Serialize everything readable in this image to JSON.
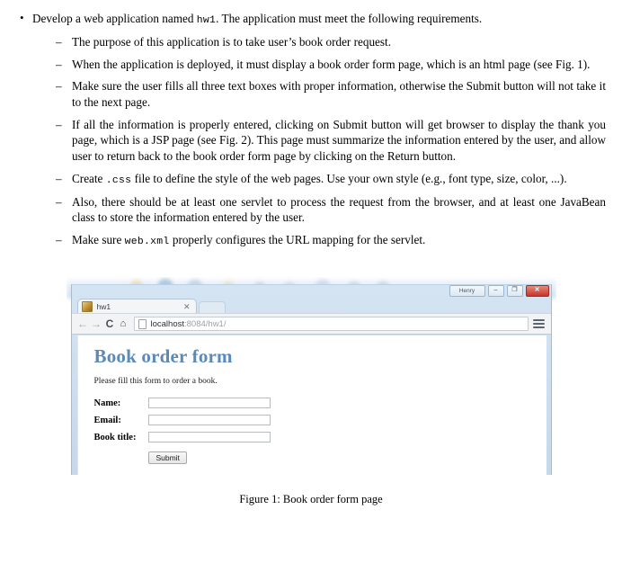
{
  "document": {
    "bullet_glyph": "•",
    "dash_glyph": "–",
    "top_item": {
      "pre": "Develop a web application named ",
      "code": "hw1",
      "post": ". The application must meet the following requirements."
    },
    "requirements": [
      {
        "id": "purpose",
        "text": "The purpose of this application is to take user’s book order request."
      },
      {
        "id": "deploy",
        "text": "When the application is deployed, it must display a book order form page, which is an html page (see Fig. 1)."
      },
      {
        "id": "validation",
        "text": "Make sure the user fills all three text boxes with proper information, otherwise the Submit button will not take it to the next page."
      },
      {
        "id": "thank-you",
        "text": "If all the information is properly entered, clicking on Submit button will get browser to display the thank you page, which is a JSP page (see Fig. 2). This page must summarize the information entered by the user, and allow user to return back to the book order form page by clicking on the Return button."
      },
      {
        "id": "css",
        "pre": "Create ",
        "code": ".css",
        "post": " file to define the style of the web pages. Use your own style (e.g., font type, size, color, ...)."
      },
      {
        "id": "servlet",
        "text": "Also, there should be at least one servlet to process the request from the browser, and at least one JavaBean class to store the information entered by the user."
      },
      {
        "id": "webxml",
        "pre": "Make sure ",
        "code": "web.xml",
        "post": " properly configures the URL mapping for the servlet."
      }
    ],
    "figure_caption": "Figure 1: Book order form page"
  },
  "screenshot": {
    "window": {
      "user_chip_label": "Henry",
      "minimize_label": "–",
      "maximize_label": "❐",
      "close_label": "✕"
    },
    "tab": {
      "title": "hw1",
      "close_label": "✕"
    },
    "toolbar": {
      "back_label": "←",
      "forward_label": "→",
      "reload_label": "C",
      "home_label": "⌂",
      "url_host": "localhost",
      "url_path": ":8084/hw1/"
    },
    "page": {
      "heading": "Book order form",
      "subtitle": "Please fill this form to order a book.",
      "fields": [
        {
          "label": "Name:",
          "value": ""
        },
        {
          "label": "Email:",
          "value": ""
        },
        {
          "label": "Book title:",
          "value": ""
        }
      ],
      "submit_label": "Submit"
    },
    "colors": {
      "heading": "#5b89b8",
      "close_button": "#c6332a",
      "window_frame": "#c5d9ec"
    }
  }
}
